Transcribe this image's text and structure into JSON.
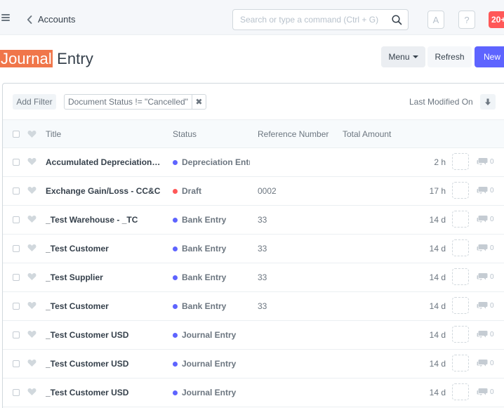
{
  "navbar": {
    "back_label": "Accounts",
    "search_placeholder": "Search or type a command (Ctrl + G)",
    "avatar_initial": "A",
    "help_label": "?",
    "notification_count": "20+"
  },
  "page": {
    "title_highlight": "Journal",
    "title_rest": " Entry",
    "menu_label": "Menu",
    "refresh_label": "Refresh",
    "new_label": "New",
    "primary_color": "#5e64ff",
    "highlight_color": "#f0764a"
  },
  "filters": {
    "add_filter_label": "Add Filter",
    "active_filter": "Document Status != \"Cancelled\"",
    "sort_label": "Last Modified On"
  },
  "columns": {
    "title": "Title",
    "status": "Status",
    "reference": "Reference Number",
    "amount": "Total Amount"
  },
  "rows": [
    {
      "title": "Accumulated Depreciation - ...",
      "status": "Depreciation Entry",
      "status_color": "#5e64ff",
      "reference": "",
      "modified": "2 h",
      "comments": "0"
    },
    {
      "title": "Exchange Gain/Loss - CC&C",
      "status": "Draft",
      "status_color": "#ff5858",
      "reference": "0002",
      "modified": "17 h",
      "comments": "0"
    },
    {
      "title": "_Test Warehouse - _TC",
      "status": "Bank Entry",
      "status_color": "#5e64ff",
      "reference": "33",
      "modified": "14 d",
      "comments": "0"
    },
    {
      "title": "_Test Customer",
      "status": "Bank Entry",
      "status_color": "#5e64ff",
      "reference": "33",
      "modified": "14 d",
      "comments": "0"
    },
    {
      "title": "_Test Supplier",
      "status": "Bank Entry",
      "status_color": "#5e64ff",
      "reference": "33",
      "modified": "14 d",
      "comments": "0"
    },
    {
      "title": "_Test Customer",
      "status": "Bank Entry",
      "status_color": "#5e64ff",
      "reference": "33",
      "modified": "14 d",
      "comments": "0"
    },
    {
      "title": "_Test Customer USD",
      "status": "Journal Entry",
      "status_color": "#5e64ff",
      "reference": "",
      "modified": "14 d",
      "comments": "0"
    },
    {
      "title": "_Test Customer USD",
      "status": "Journal Entry",
      "status_color": "#5e64ff",
      "reference": "",
      "modified": "14 d",
      "comments": "0"
    },
    {
      "title": "_Test Customer USD",
      "status": "Journal Entry",
      "status_color": "#5e64ff",
      "reference": "",
      "modified": "14 d",
      "comments": "0"
    }
  ]
}
